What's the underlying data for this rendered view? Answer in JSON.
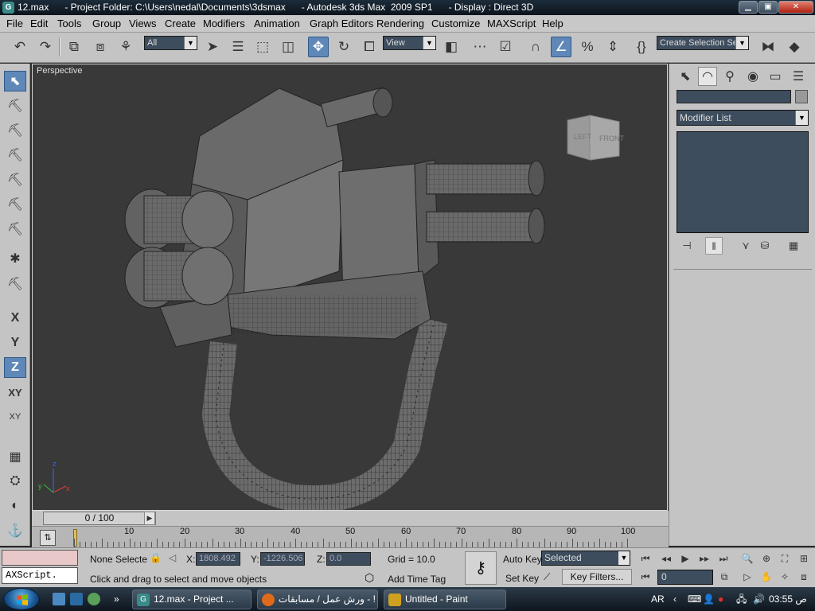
{
  "titlebar": {
    "text": "12.max      - Project Folder: C:\\Users\\nedal\\Documents\\3dsmax      - Autodesk 3ds Max  2009 SP1      - Display : Direct 3D",
    "app_icon_letter": "G",
    "minimize": "▁",
    "maximize": "▣",
    "close": "✕"
  },
  "menu": {
    "items": [
      "File",
      "Edit",
      "Tools",
      "Group",
      "Views",
      "Create",
      "Modifiers",
      "Animation",
      "Graph Editors",
      "Rendering",
      "Customize",
      "MAXScript",
      "Help"
    ]
  },
  "toolbar": {
    "selection_filter": "All",
    "ref_coord": "View",
    "selection_set": "Create Selection Set",
    "snap_num": "3"
  },
  "left_toolbar": {
    "axis_x": "X",
    "axis_y": "Y",
    "axis_z": "Z",
    "axis_xy": "XY",
    "superscript_xy": "XY"
  },
  "viewport": {
    "label": "Perspective",
    "viewcube_left": "LEFT",
    "viewcube_front": "FRONT",
    "axis_x": "x",
    "axis_y": "y",
    "axis_z": "z"
  },
  "time_slider": {
    "label": "0 / 100"
  },
  "track_bar": {
    "labels": [
      "10",
      "20",
      "30",
      "40",
      "50",
      "60",
      "70",
      "80",
      "90",
      "100"
    ]
  },
  "command_panel": {
    "modifier_list": "Modifier List"
  },
  "status": {
    "selection": "None Selecte",
    "x_label": "X:",
    "x_value": "1808.492",
    "y_label": "Y:",
    "y_value": "-1226.506",
    "z_label": "Z:",
    "z_value": "0.0",
    "grid": "Grid = 10.0",
    "prompt": "Click and drag to select and move objects",
    "add_time_tag": "Add Time Tag",
    "auto_key": "Auto Key",
    "set_key": "Set Key",
    "selected": "Selected",
    "key_filters": "Key Filters...",
    "frame": "0",
    "maxscript_line": "AXScript."
  },
  "taskbar": {
    "tasks": [
      "12.max      - Project ...",
      "ورش عمل / مسابقات - ! ...",
      "Untitled - Paint"
    ],
    "lang": "AR",
    "time": "03:55 ص"
  },
  "colors": {
    "accent": "#5f88b8",
    "panel": "#c4c4c4",
    "viewport": "#393939",
    "field": "#3d4d5d"
  }
}
